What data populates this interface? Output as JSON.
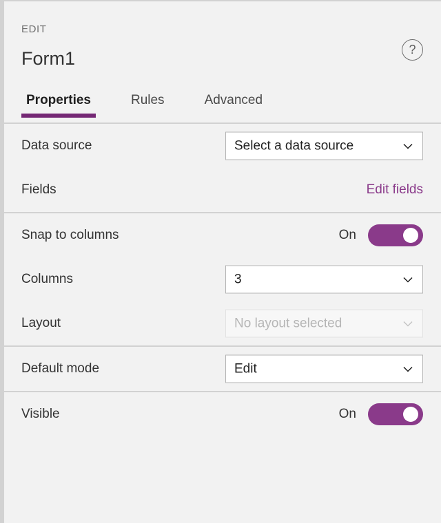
{
  "header": {
    "eyebrow": "EDIT",
    "title": "Form1",
    "help_icon_label": "?",
    "help_icon_name": "help-circle-icon"
  },
  "tabs": [
    {
      "label": "Properties",
      "active": true
    },
    {
      "label": "Rules",
      "active": false
    },
    {
      "label": "Advanced",
      "active": false
    }
  ],
  "sections": [
    {
      "rows": [
        {
          "label": "Data source",
          "control": "dropdown",
          "value": "Select a data source",
          "disabled": false
        },
        {
          "label": "Fields",
          "control": "link",
          "value": "Edit fields"
        }
      ]
    },
    {
      "rows": [
        {
          "label": "Snap to columns",
          "control": "toggle",
          "value": "On",
          "on": true
        },
        {
          "label": "Columns",
          "control": "dropdown",
          "value": "3",
          "disabled": false
        },
        {
          "label": "Layout",
          "control": "dropdown",
          "value": "No layout selected",
          "disabled": true
        }
      ]
    },
    {
      "rows": [
        {
          "label": "Default mode",
          "control": "dropdown",
          "value": "Edit",
          "disabled": false
        }
      ]
    },
    {
      "rows": [
        {
          "label": "Visible",
          "control": "toggle",
          "value": "On",
          "on": true
        }
      ]
    }
  ],
  "colors": {
    "accent": "#8a3a8a",
    "accent_underline": "#742774",
    "panel_bg": "#f2f2f2",
    "divider": "#d2d2d2",
    "text": "#333333",
    "muted_text": "#6e6e6e"
  }
}
